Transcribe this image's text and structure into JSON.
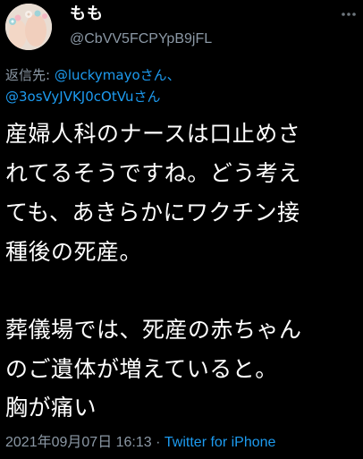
{
  "author": {
    "display_name": "もも",
    "handle": "@CbVV5FCPYpB9jFL"
  },
  "reply": {
    "prefix": "返信先: ",
    "mention1": "@luckymayoさん、",
    "mention2": "@3osVyJVKJ0cOtVuさん"
  },
  "tweet": {
    "lines": [
      "産婦人科のナースは口止めさ",
      "れてるそうですね。どう考え",
      "ても、あきらかにワクチン接",
      "種後の死産。",
      "",
      "葬儀場では、死産の赤ちゃん",
      "のご遺体が増えていると。",
      "胸が痛い"
    ]
  },
  "footer": {
    "timestamp": "2021年09月07日 16:13",
    "separator": " · ",
    "source": "Twitter for iPhone"
  },
  "icons": {
    "more": "more-options-icon",
    "avatar": "avatar-image"
  },
  "colors": {
    "background": "#000000",
    "text": "#ffffff",
    "secondary": "#8b98a5",
    "link": "#1d9bf0"
  }
}
